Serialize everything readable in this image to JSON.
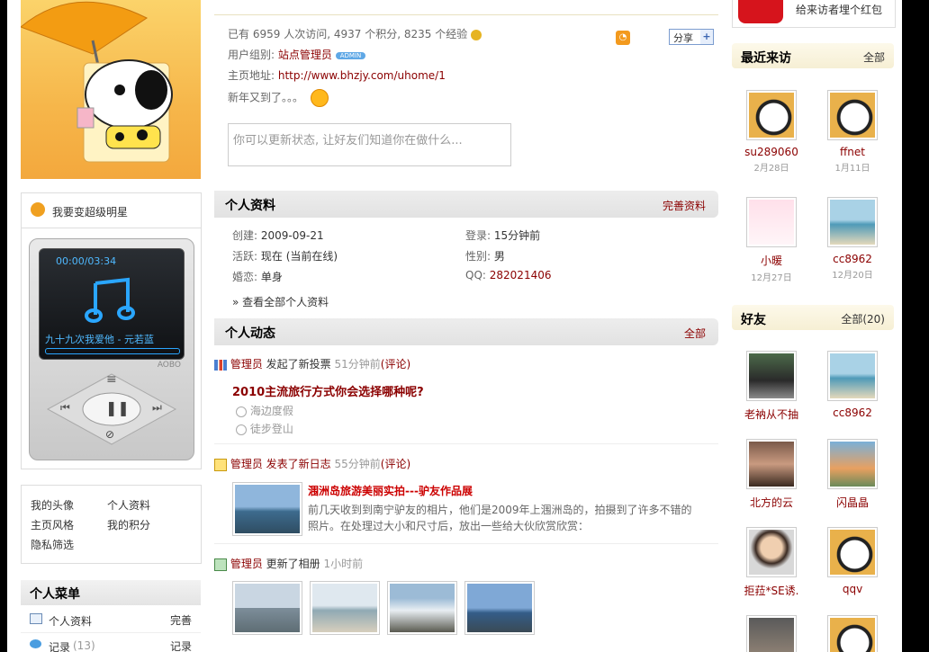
{
  "top_banner": {
    "text": "给来访者埋个红包"
  },
  "stats": {
    "prefix": "已有",
    "visits": "6959",
    "visits_unit": "人次访问,",
    "points": "4937",
    "points_unit": "个积分,",
    "exp": "8235",
    "exp_unit": "个经验"
  },
  "share": {
    "label": "分享"
  },
  "user": {
    "group_label": "用户组别:",
    "group": "站点管理员",
    "badge": "ADMIN",
    "home_label": "主页地址:",
    "home_url": "http://www.bhzjy.com/uhome/1",
    "status_text": "新年又到了。。。"
  },
  "status_input": {
    "placeholder": "你可以更新状态, 让好友们知道你在做什么..."
  },
  "left": {
    "star_label": "我要变超级明星",
    "player": {
      "time": "00:00/03:34",
      "song": "九十九次我爱他 - 元若蓝",
      "brand": "AOBO"
    },
    "links": [
      "我的头像",
      "个人资料",
      "主页风格",
      "我的积分",
      "隐私筛选"
    ],
    "menu_title": "个人菜单",
    "menu": [
      {
        "label": "个人资料",
        "count": "",
        "action": "完善"
      },
      {
        "label": "记录",
        "count": "(13)",
        "action": "记录"
      }
    ]
  },
  "profile": {
    "title": "个人资料",
    "action": "完善资料",
    "created_label": "创建:",
    "created": "2009-09-21",
    "login_label": "登录:",
    "login": "15分钟前",
    "active_label": "活跃:",
    "active": "现在 (当前在线)",
    "gender_label": "性别:",
    "gender": "男",
    "marital_label": "婚恋:",
    "marital": "单身",
    "qq_label": "QQ:",
    "qq": "282021406",
    "view_all": "» 查看全部个人资料"
  },
  "feed": {
    "title": "个人动态",
    "action": "全部",
    "items": [
      {
        "user": "管理员",
        "action": "发起了新投票",
        "time": "51分钟前",
        "comment": "(评论)"
      },
      {
        "user": "管理员",
        "action": "发表了新日志",
        "time": "55分钟前",
        "comment": "(评论)"
      },
      {
        "user": "管理员",
        "action": "更新了相册",
        "time": "1小时前",
        "comment": ""
      }
    ],
    "poll": {
      "question": "2010主流旅行方式你会选择哪种呢?",
      "options": [
        "海边度假",
        "徒步登山"
      ]
    },
    "blog": {
      "title": "涠洲岛旅游美丽实拍---驴友作品展",
      "line1": "前几天收到到南宁驴友的相片，他们是2009年上涠洲岛的，拍摄到了许多不错的",
      "line2": "照片。在处理过大小和尺寸后，放出一些给大伙欣赏欣赏："
    }
  },
  "visitors": {
    "title": "最近来访",
    "action": "全部",
    "items": [
      {
        "name": "su289060",
        "date": "2月28日"
      },
      {
        "name": "ffnet",
        "date": "1月11日"
      },
      {
        "name": "小暖",
        "date": "12月27日"
      },
      {
        "name": "cc8962",
        "date": "12月20日"
      }
    ]
  },
  "friends": {
    "title": "好友",
    "action": "全部(20)",
    "items": [
      {
        "name": "老衲从不抽"
      },
      {
        "name": "cc8962"
      },
      {
        "name": "北方的云"
      },
      {
        "name": "闪晶晶"
      },
      {
        "name": "拒菈*SE诱."
      },
      {
        "name": "qqv"
      }
    ]
  },
  "colors": {
    "accent": "#8b0000",
    "header_bg": "#e6e6e6",
    "side_head_bg": "#f8f1da"
  }
}
